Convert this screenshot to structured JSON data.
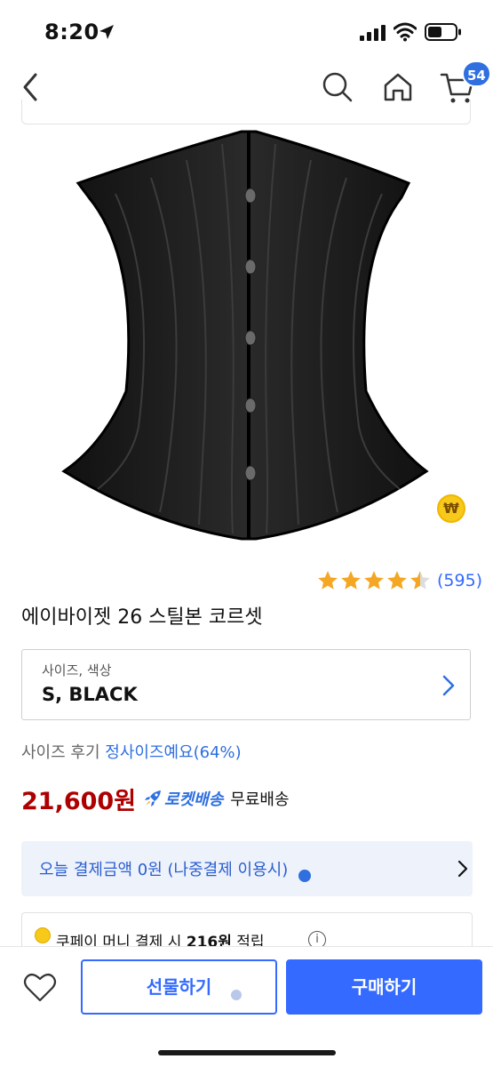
{
  "status_bar": {
    "time": "8:20"
  },
  "nav": {
    "cart_count": "54"
  },
  "product": {
    "coin_symbol": "₩",
    "rating_value": 4.5,
    "review_count": "(595)",
    "title": "에이바이젯 26 스틸본 코르셋"
  },
  "option": {
    "label": "사이즈, 색상",
    "value": "S, BLACK"
  },
  "size_review": {
    "label": "사이즈 후기",
    "value": "정사이즈예요(64%)"
  },
  "price": {
    "amount": "21,600원",
    "rocket_label": "로켓배송",
    "shipping": "무료배송"
  },
  "pay_later": {
    "text": "오늘 결제금액 0원 (나중결제 이용시)"
  },
  "coupay": {
    "text_prefix": "쿠페이 머니 결제 시",
    "amount": "216원",
    "text_suffix": "적립",
    "info_symbol": "i"
  },
  "bottom_bar": {
    "gift_label": "선물하기",
    "buy_label": "구매하기"
  },
  "colors": {
    "accent": "#346aff",
    "price_red": "#ae0000",
    "star_gold": "#f5a623"
  }
}
